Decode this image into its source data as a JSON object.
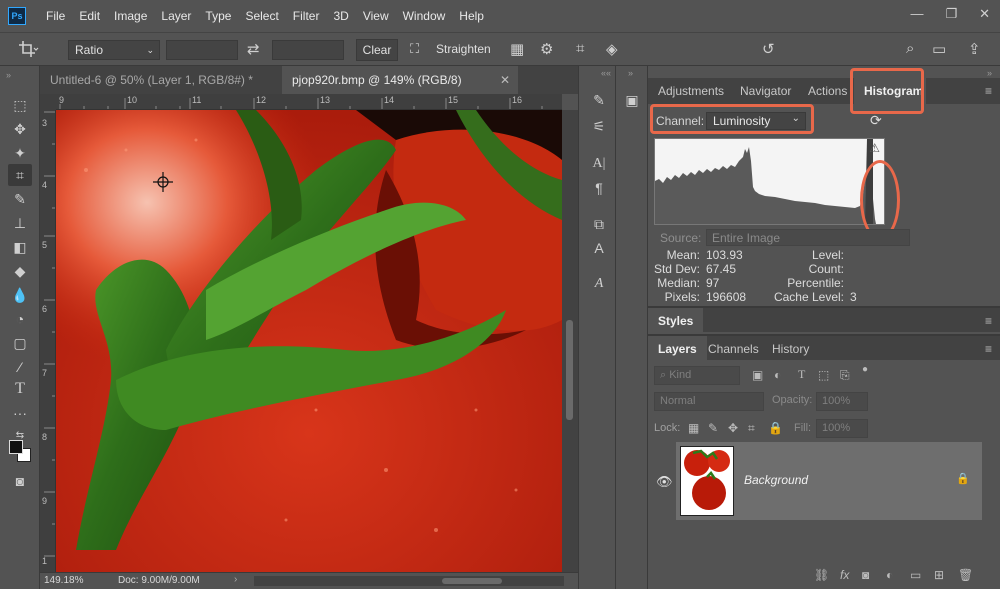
{
  "app": {
    "logo": "Ps"
  },
  "menu": [
    "File",
    "Edit",
    "Image",
    "Layer",
    "Type",
    "Select",
    "Filter",
    "3D",
    "View",
    "Window",
    "Help"
  ],
  "window_controls": [
    "—",
    "❐",
    "✕"
  ],
  "options": {
    "ratio": "Ratio",
    "clear": "Clear",
    "straighten": "Straighten"
  },
  "doc_tabs": [
    {
      "label": "Untitled-6 @ 50% (Layer 1, RGB/8#) *",
      "active": false
    },
    {
      "label": "pjop920r.bmp @ 149% (RGB/8)",
      "active": true
    }
  ],
  "ruler": {
    "top": [
      "9",
      "10",
      "11",
      "12",
      "13",
      "14",
      "15",
      "16"
    ],
    "left": [
      "3",
      "4",
      "5",
      "6",
      "7",
      "8",
      "9",
      "1"
    ]
  },
  "status": {
    "zoom": "149.18%",
    "doc": "Doc: 9.00M/9.00M"
  },
  "panels": {
    "tabs_top": [
      "Adjustments",
      "Navigator",
      "Actions",
      "Histogram"
    ],
    "active_top": "Histogram",
    "histogram": {
      "channel_label": "Channel:",
      "channel_value": "Luminosity",
      "source_label": "Source:",
      "source_value": "Entire Image",
      "stats_left": [
        {
          "label": "Mean:",
          "value": "103.93"
        },
        {
          "label": "Std Dev:",
          "value": "67.45"
        },
        {
          "label": "Median:",
          "value": "97"
        },
        {
          "label": "Pixels:",
          "value": "196608"
        }
      ],
      "stats_right": [
        {
          "label": "Level:",
          "value": ""
        },
        {
          "label": "Count:",
          "value": ""
        },
        {
          "label": "Percentile:",
          "value": ""
        },
        {
          "label": "Cache Level:",
          "value": "3"
        }
      ]
    },
    "styles_label": "Styles",
    "layers_tabs": [
      "Layers",
      "Channels",
      "History"
    ],
    "layers": {
      "kind_label": "Kind",
      "blend_mode": "Normal",
      "opacity_label": "Opacity:",
      "opacity_value": "100%",
      "lock_label": "Lock:",
      "fill_label": "Fill:",
      "fill_value": "100%",
      "items": [
        {
          "name": "Background"
        }
      ]
    }
  }
}
